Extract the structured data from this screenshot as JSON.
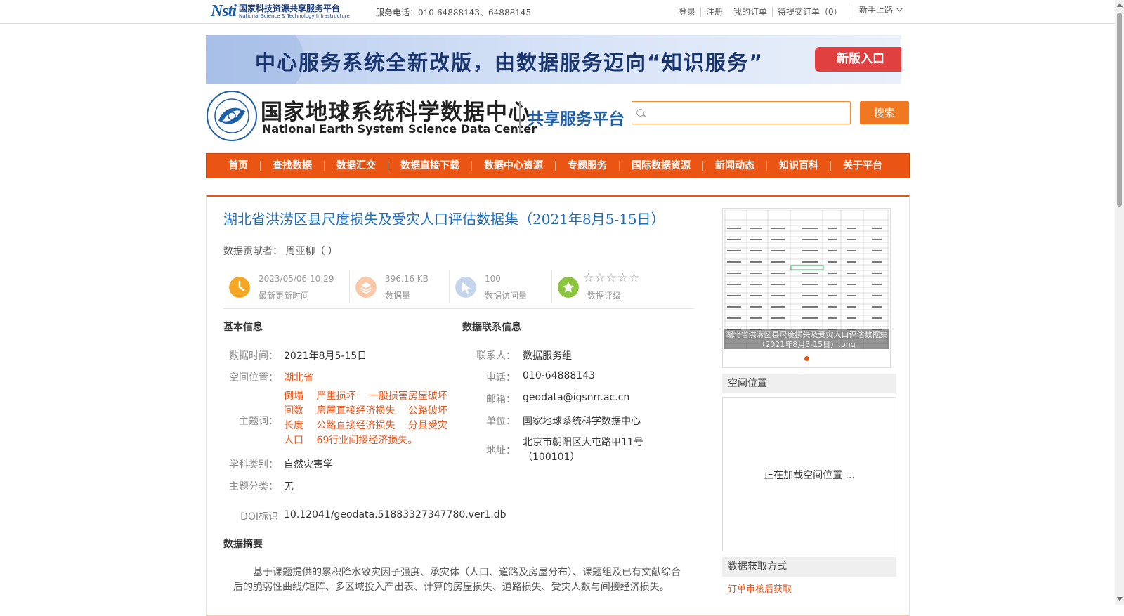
{
  "topbar": {
    "logo_mark": "Nsti",
    "logo_cn": "国家科技资源共享服务平台",
    "logo_en": "National Science & Technology Infrastructure",
    "service_phone": "服务电话：010-64888143、64888145",
    "links": [
      "登录",
      "注册",
      "我的订单",
      "待提交订单（0）"
    ],
    "newbie": "新手上路"
  },
  "banner": {
    "text": "中心服务系统全新改版，由数据服务迈向“知识服务”",
    "button": "新版入口"
  },
  "header": {
    "center_name_cn": "国家地球系统科学数据中心",
    "center_name_en": "National Earth System Science Data Center",
    "platform": "共享服务平台",
    "search_placeholder": "",
    "search_button": "搜索"
  },
  "nav": [
    "首页",
    "查找数据",
    "数据汇交",
    "数据直接下载",
    "数据中心资源",
    "专题服务",
    "国际数据资源",
    "新闻动态",
    "知识百科",
    "关于平台"
  ],
  "dataset": {
    "title": "湖北省洪涝区县尺度损失及受灾人口评估数据集（2021年8月5-15日）",
    "contributor_label": "数据贡献者：",
    "contributor": "周亚柳（ ）",
    "stats": [
      {
        "value": "2023/05/06 10:29",
        "label": "最新更新时间",
        "icon": "clock-icon",
        "color": "#f5a623"
      },
      {
        "value": "396.16 KB",
        "label": "数据量",
        "icon": "layers-icon",
        "color": "#f7c9a8"
      },
      {
        "value": "100",
        "label": "数据访问量",
        "icon": "visits-icon",
        "color": "#c5d6ec"
      },
      {
        "value": "☆☆☆☆☆",
        "label": "数据评级",
        "icon": "star-icon",
        "color": "#8cc63f"
      }
    ]
  },
  "basic_info": {
    "heading": "基本信息",
    "time_label": "数据时间：",
    "time_value": "2021年8月5-15日",
    "location_label": "空间位置：",
    "location_value": "湖北省",
    "keywords_label": "主题词：",
    "keywords": [
      "倒塌",
      "严重损坏",
      "一般损害房屋破坏间数",
      "房屋直接经济损失",
      "公路破坏长度",
      "公路直接经济损失",
      "分县受灾人口",
      "69行业间接经济损失。"
    ],
    "subject_label": "学科类别：",
    "subject_value": "自然灾害学",
    "theme_label": "主题分类：",
    "theme_value": "无",
    "doi_label": "DOI标识",
    "doi_value": "10.12041/geodata.51883327347780.ver1.db"
  },
  "contact_info": {
    "heading": "数据联系信息",
    "contact_label": "联系人：",
    "contact_value": "数据服务组",
    "phone_label": "电话：",
    "phone_value": "010-64888143",
    "email_label": "邮箱：",
    "email_value": "geodata@igsnrr.ac.cn",
    "unit_label": "单位：",
    "unit_value": "国家地球系统科学数据中心",
    "address_label": "地址：",
    "address_value": "北京市朝阳区大屯路甲11号（100101）"
  },
  "abstract": {
    "heading": "数据摘要",
    "text": "基于课题提供的累积降水致灾因子强度、承灾体（人口、道路及房屋分布）、课题组及已有文献综合后的脆弱性曲线/矩阵、多区域投入产出表、计算的房屋损失、道路损失、受灾人数与间接经济损失。"
  },
  "sidebar": {
    "thumb_caption": "湖北省洪涝区县尺度损失及受灾人口评估数据集（2021年8月5-15日）.png",
    "spatial_heading": "空间位置",
    "map_loading": "正在加载空间位置 ...",
    "access_heading": "数据获取方式",
    "access_link": "订单审核后获取"
  },
  "colors": {
    "accent": "#ea5514",
    "title_blue": "#1f6fc0",
    "link_orange": "#e8541a"
  }
}
